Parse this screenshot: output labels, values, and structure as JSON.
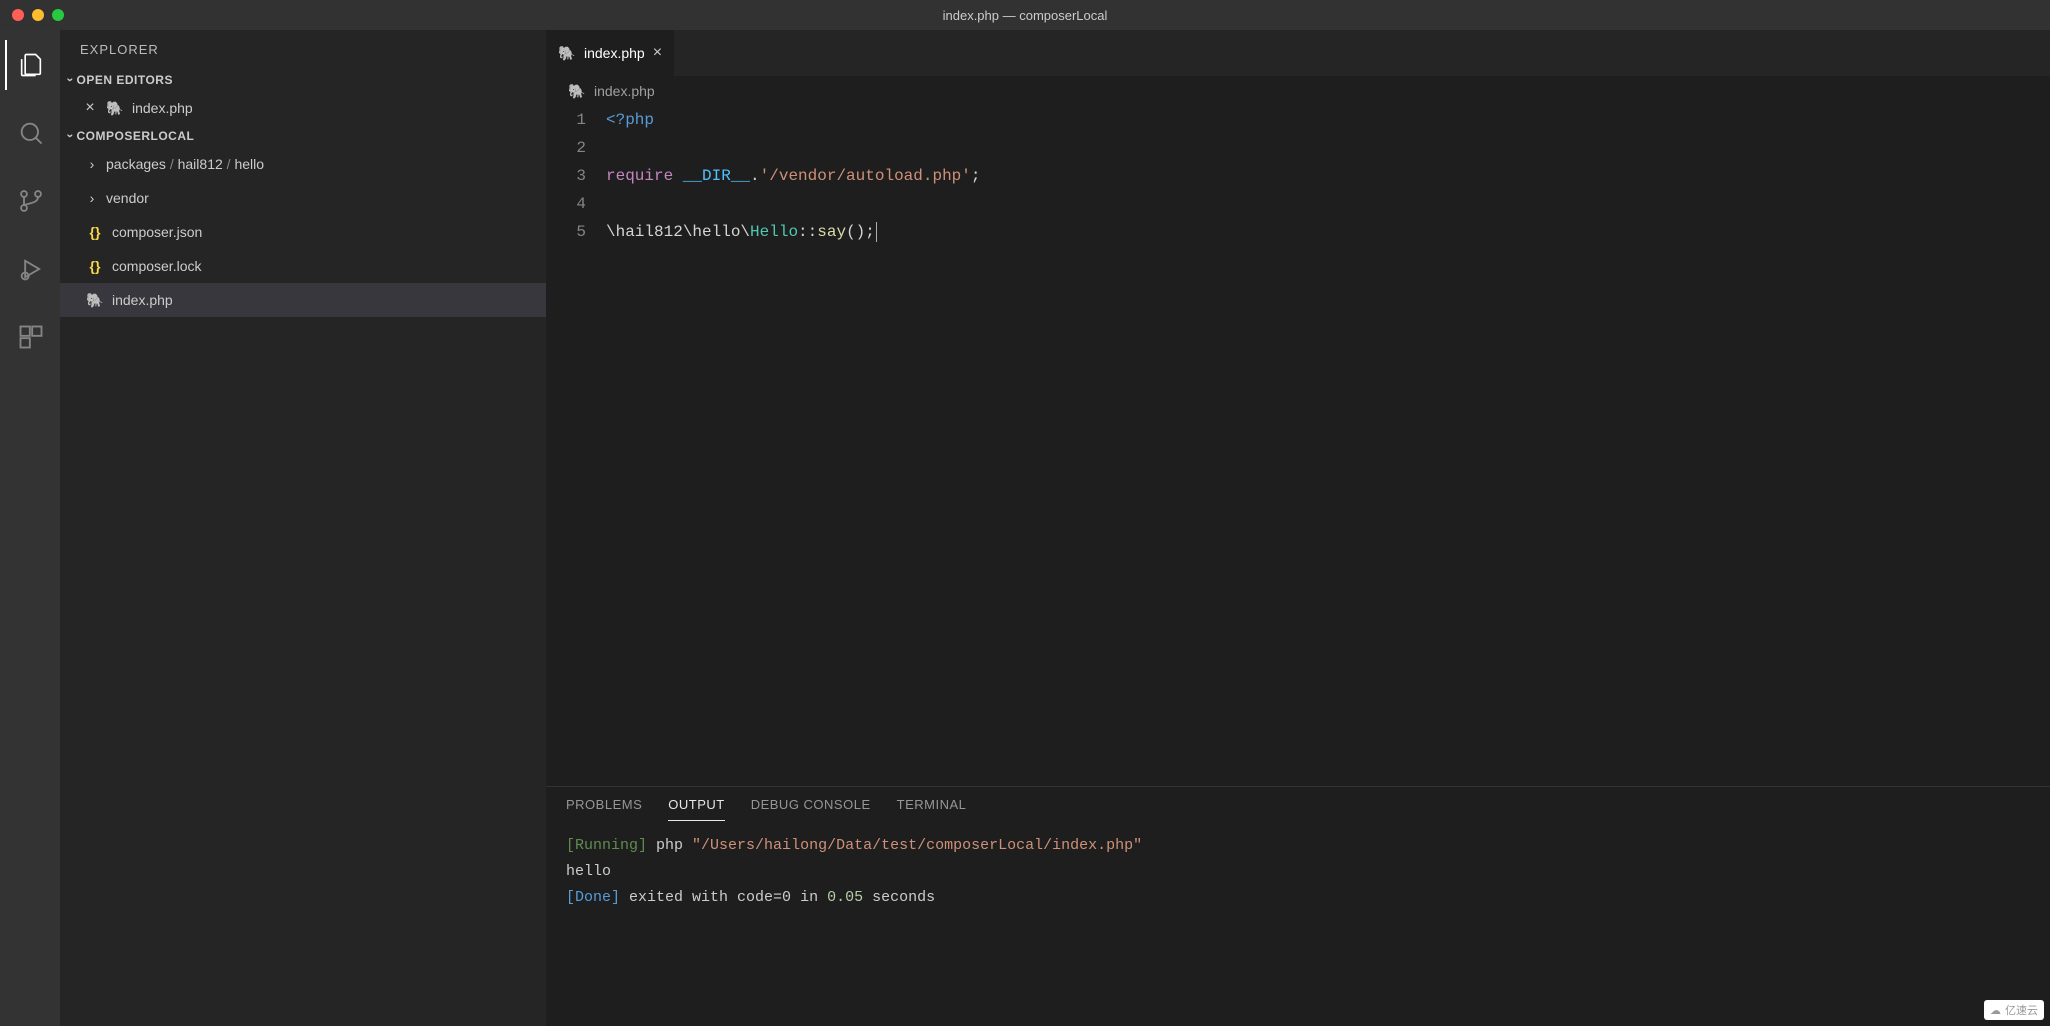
{
  "window": {
    "title": "index.php — composerLocal"
  },
  "sidebar": {
    "title": "EXPLORER",
    "openEditors": {
      "label": "OPEN EDITORS",
      "items": [
        {
          "name": "index.php"
        }
      ]
    },
    "workspace": {
      "label": "COMPOSERLOCAL",
      "items": [
        {
          "type": "folder-path",
          "display": "packages / hail812 / hello"
        },
        {
          "type": "folder",
          "display": "vendor"
        },
        {
          "type": "file-json",
          "display": "composer.json"
        },
        {
          "type": "file-json",
          "display": "composer.lock"
        },
        {
          "type": "file-php",
          "display": "index.php",
          "selected": true
        }
      ]
    }
  },
  "tabs": [
    {
      "name": "index.php",
      "active": true
    }
  ],
  "breadcrumb": {
    "file": "index.php"
  },
  "editor": {
    "lines": [
      {
        "n": "1",
        "tokens": [
          {
            "t": "<?php",
            "c": "tk-tag"
          }
        ]
      },
      {
        "n": "2",
        "tokens": []
      },
      {
        "n": "3",
        "tokens": [
          {
            "t": "require ",
            "c": "tk-keyword"
          },
          {
            "t": "__DIR__",
            "c": "tk-const"
          },
          {
            "t": ".",
            "c": "tk-punct"
          },
          {
            "t": "'/vendor/autoload.php'",
            "c": "tk-string"
          },
          {
            "t": ";",
            "c": "tk-punct"
          }
        ]
      },
      {
        "n": "4",
        "tokens": []
      },
      {
        "n": "5",
        "tokens": [
          {
            "t": "\\hail812\\hello\\",
            "c": "tk-punct"
          },
          {
            "t": "Hello",
            "c": "tk-class"
          },
          {
            "t": "::",
            "c": "tk-punct"
          },
          {
            "t": "say",
            "c": "tk-func"
          },
          {
            "t": "();",
            "c": "tk-punct"
          }
        ],
        "cursor": true
      }
    ]
  },
  "panel": {
    "tabs": {
      "problems": "PROBLEMS",
      "output": "OUTPUT",
      "debug": "DEBUG CONSOLE",
      "terminal": "TERMINAL"
    },
    "output": {
      "running_label": "[Running]",
      "running_cmd": "php ",
      "running_path": "\"/Users/hailong/Data/test/composerLocal/index.php\"",
      "hello": "hello",
      "done_label": "[Done]",
      "done_text1": " exited with ",
      "done_code": "code=0",
      "done_text2": " in ",
      "done_time": "0.05",
      "done_text3": " seconds"
    }
  },
  "watermark": "亿速云"
}
